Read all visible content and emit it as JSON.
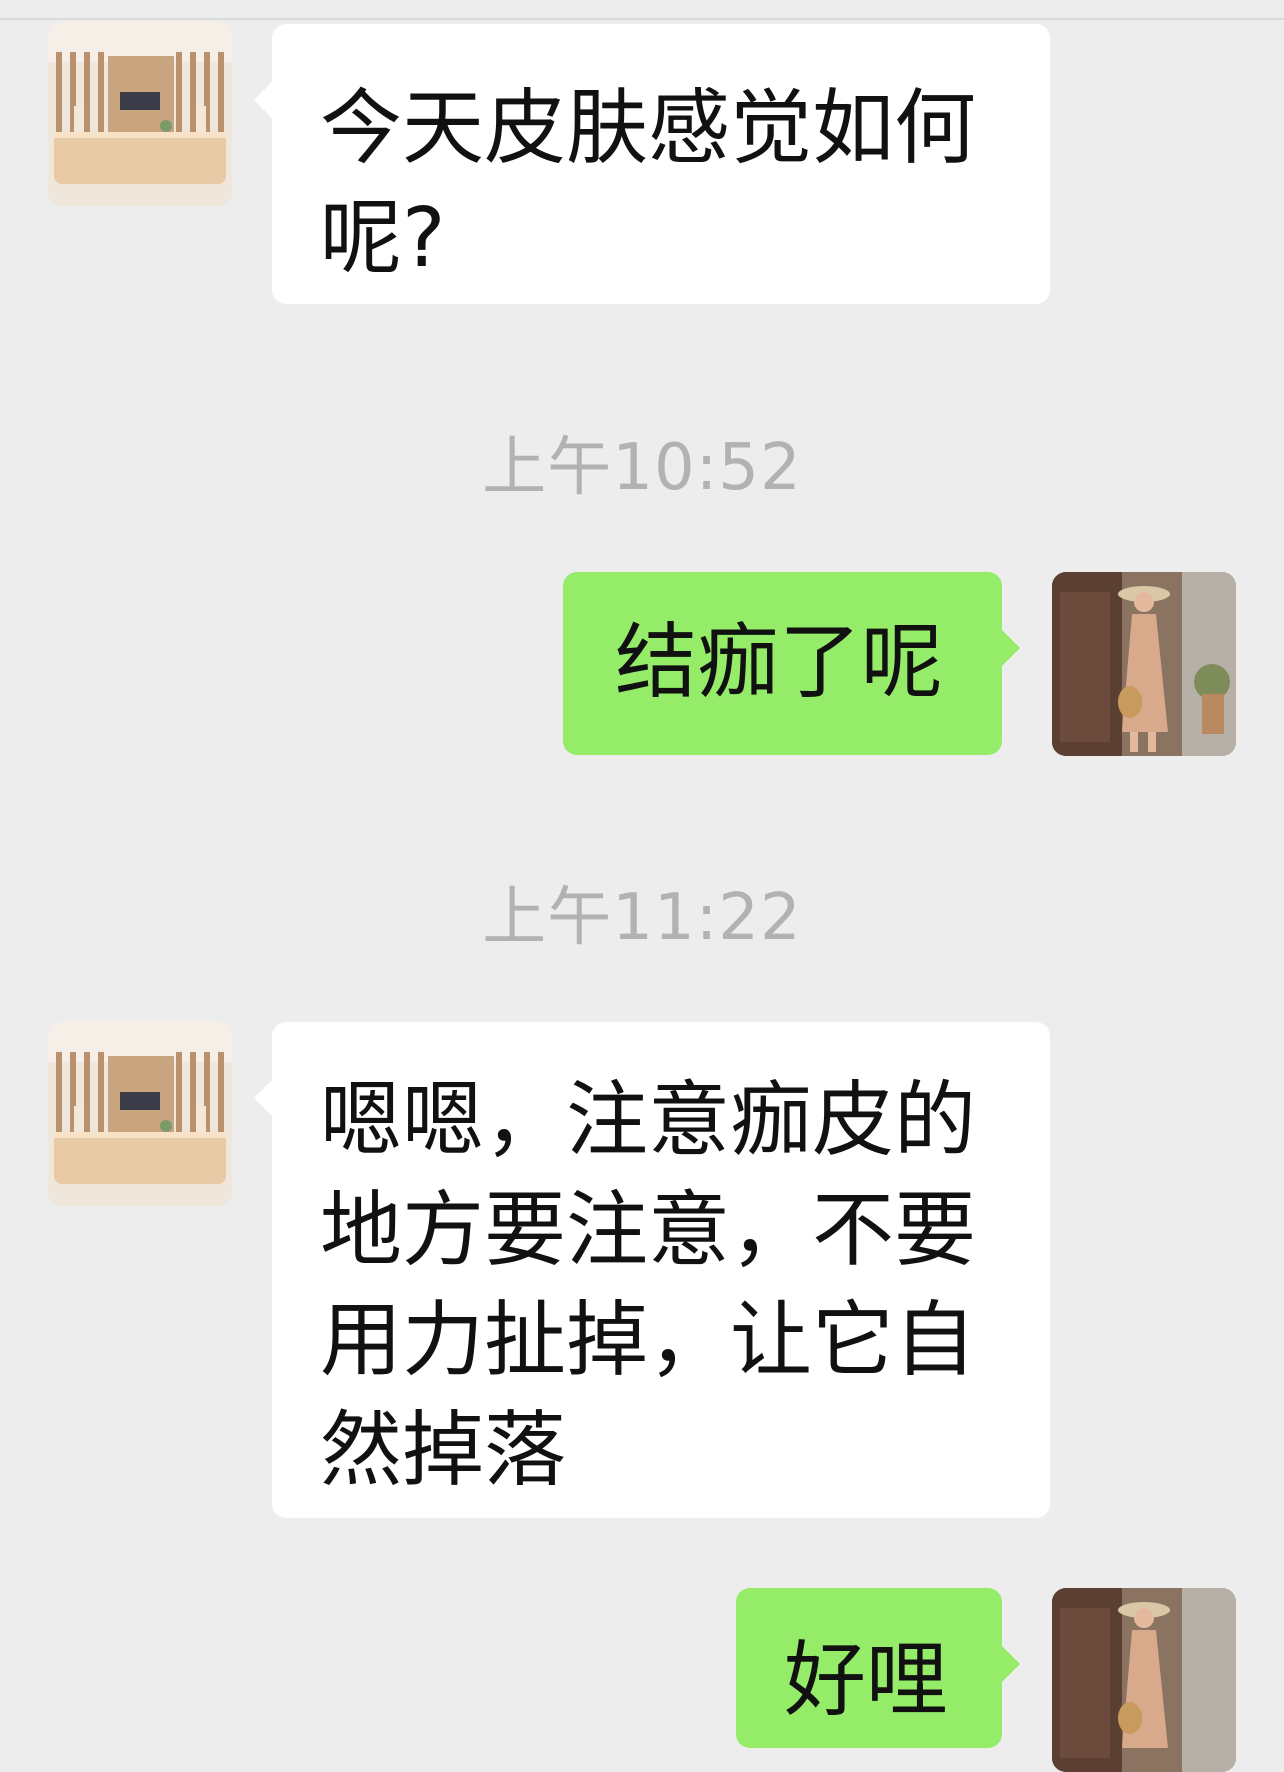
{
  "chat": {
    "messages": [
      {
        "sender": "contact",
        "text": "今天皮肤感觉如何呢?"
      },
      {
        "timestamp": "上午10:52"
      },
      {
        "sender": "me",
        "text": "结痂了呢"
      },
      {
        "timestamp": "上午11:22"
      },
      {
        "sender": "contact",
        "text": "嗯嗯，注意痂皮的地方要注意，不要用力扯掉，让它自然掉落"
      },
      {
        "sender": "me",
        "text": "好哩"
      }
    ]
  },
  "colors": {
    "background": "#ededed",
    "incoming_bubble": "#ffffff",
    "outgoing_bubble": "#95ec69",
    "timestamp_text": "#b2b2b2"
  },
  "icons": {
    "contact_avatar": "store-reception-avatar-icon",
    "user_avatar": "woman-in-dress-avatar-icon"
  }
}
